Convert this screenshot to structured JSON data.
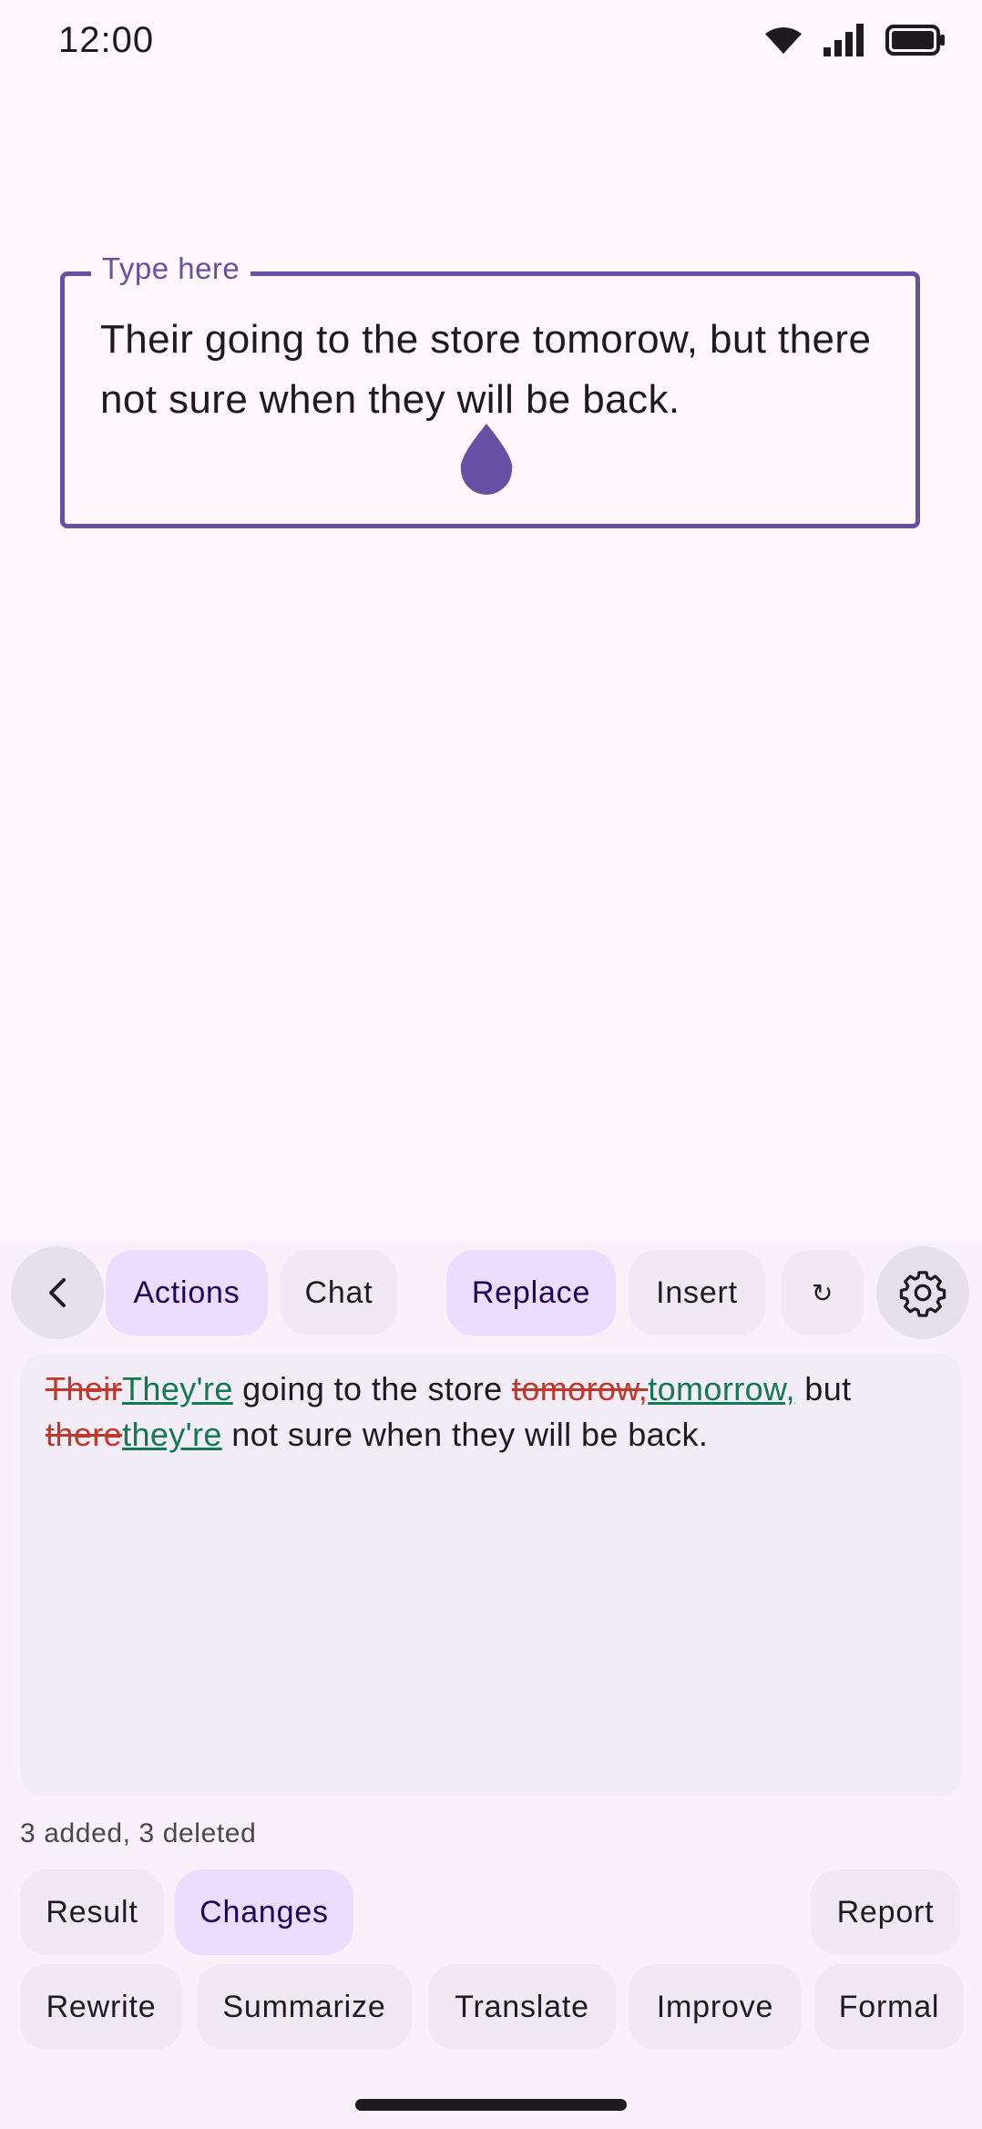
{
  "status_bar": {
    "time": "12:00",
    "icons": [
      "wifi-icon",
      "signal-icon",
      "battery-icon"
    ]
  },
  "editor": {
    "label": "Type here",
    "text": "Their going to the store tomorow, but there not sure when they will be back."
  },
  "toolbar": {
    "back_icon": "chevron-left-icon",
    "actions_label": "Actions",
    "chat_label": "Chat",
    "replace_label": "Replace",
    "insert_label": "Insert",
    "refresh_symbol": "↻",
    "settings_icon": "gear-icon"
  },
  "diff": {
    "line1": {
      "del1": "Their",
      "ins1": "They're",
      "mid1": " going to the store ",
      "del2": "tomorow,",
      "ins2": "tomorrow,",
      "end1": " but"
    },
    "line2": {
      "del3": "there",
      "ins3": "they're",
      "end2": " not sure when they will be back."
    }
  },
  "summary": "3 added, 3 deleted",
  "view_tabs": {
    "result_label": "Result",
    "changes_label": "Changes",
    "report_label": "Report"
  },
  "commands": [
    "Rewrite",
    "Summarize",
    "Translate",
    "Improve",
    "Formal"
  ],
  "colors": {
    "accent": "#6750a4",
    "deleted": "#c0392b",
    "inserted": "#127a52",
    "selected_chip": "#eaddff"
  }
}
